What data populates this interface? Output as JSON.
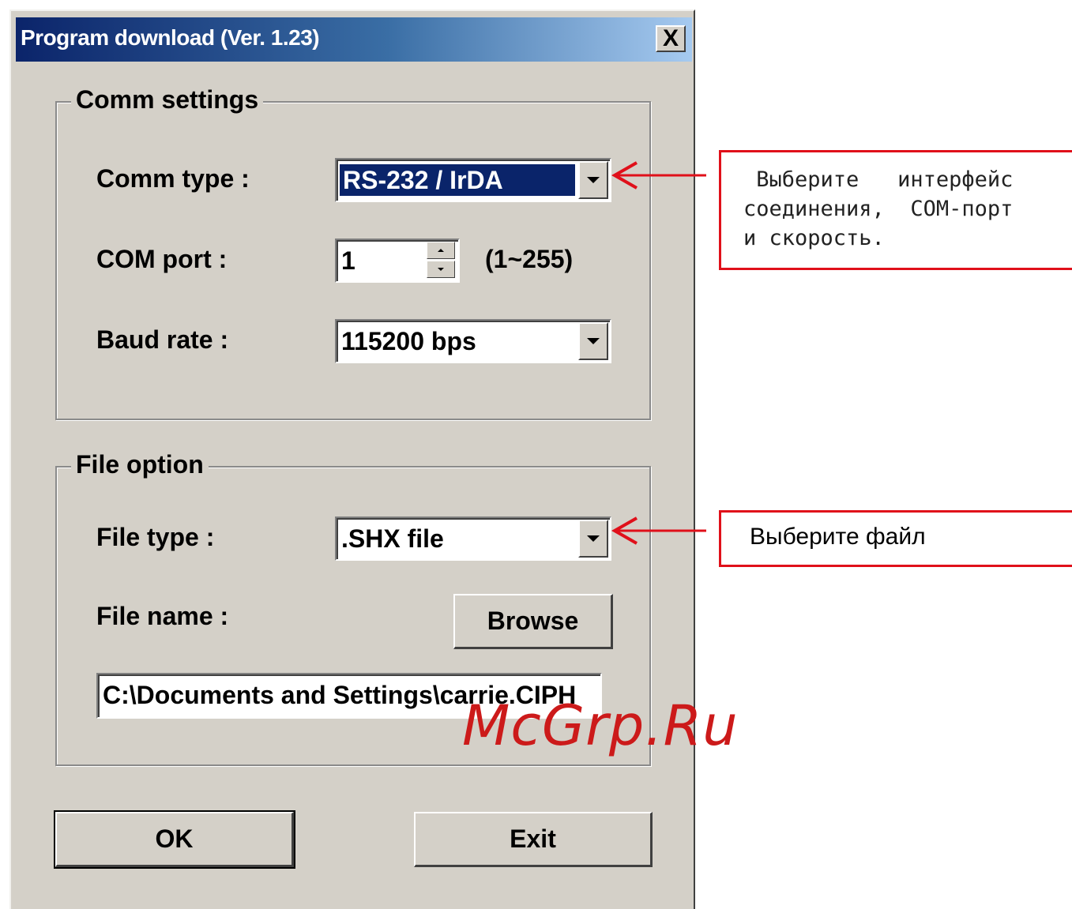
{
  "window": {
    "title": "Program download  (Ver. 1.23)",
    "close_label": "X"
  },
  "comm_settings": {
    "legend": "Comm settings",
    "comm_type_label": "Comm type :",
    "comm_type_value": "RS-232 / IrDA",
    "com_port_label": "COM port :",
    "com_port_value": "1",
    "com_port_range": "(1~255)",
    "baud_rate_label": "Baud rate :",
    "baud_rate_value": "115200 bps"
  },
  "file_option": {
    "legend": "File option",
    "file_type_label": "File type :",
    "file_type_value": ".SHX file",
    "file_name_label": "File name :",
    "browse_label": "Browse",
    "file_path_value": "C:\\Documents and Settings\\carrie.CIPH"
  },
  "buttons": {
    "ok_label": "OK",
    "exit_label": "Exit"
  },
  "annotations": {
    "comm_note_line1": " Выберите   интерфейс",
    "comm_note_line2": "соединения,  СОМ-порт",
    "comm_note_line3": "и скорость.",
    "file_note": "Выберите файл"
  },
  "watermark": "McGrp.Ru",
  "colors": {
    "callout_border": "#e0101a",
    "title_start": "#0b246a",
    "title_end": "#a6caf0",
    "dialog_bg": "#d4d0c8"
  }
}
